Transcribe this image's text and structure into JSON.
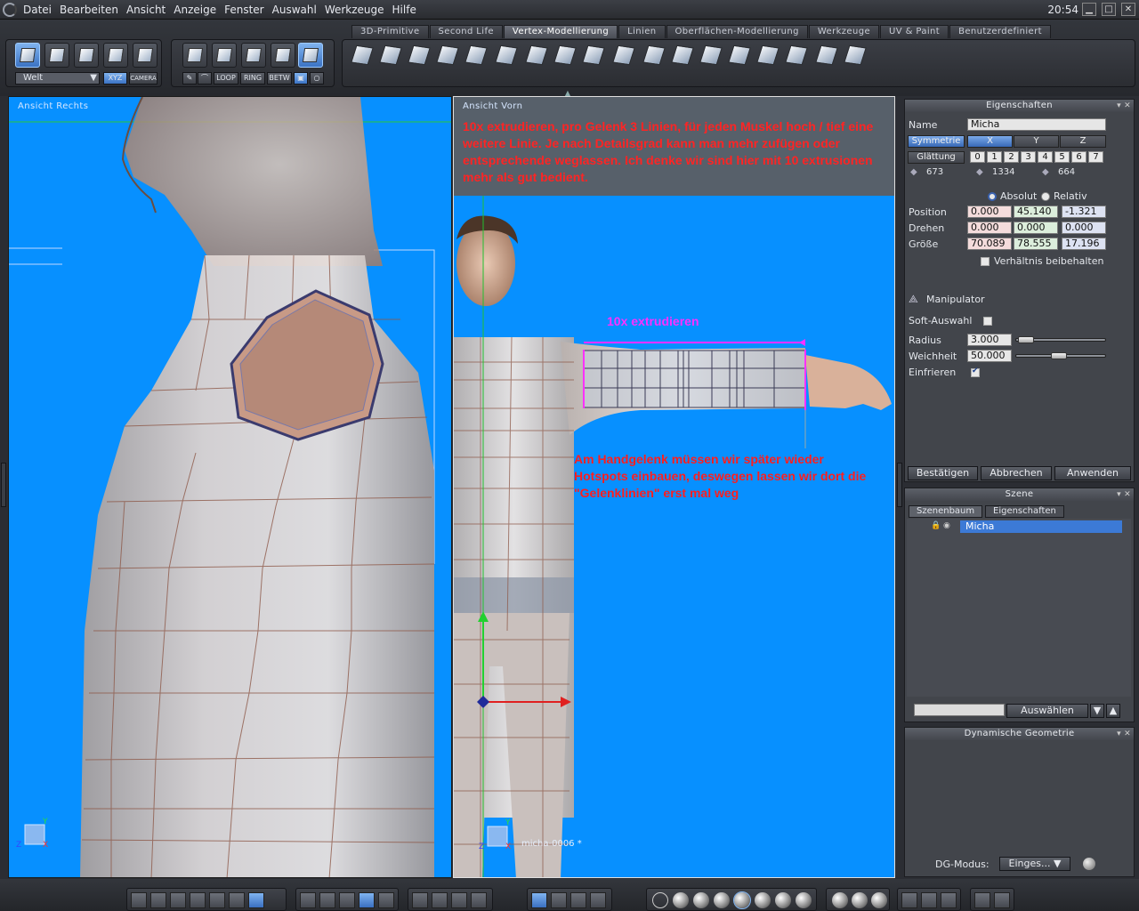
{
  "menubar": {
    "items": [
      "Datei",
      "Bearbeiten",
      "Ansicht",
      "Anzeige",
      "Fenster",
      "Auswahl",
      "Werkzeuge",
      "Hilfe"
    ],
    "clock": "20:54"
  },
  "toolbar": {
    "tabs": [
      "3D-Primitive",
      "Second Life",
      "Vertex-Modellierung",
      "Linien",
      "Oberflächen-Modellierung",
      "Werkzeuge",
      "UV & Paint",
      "Benutzerdefiniert"
    ],
    "active_tab": "Vertex-Modellierung",
    "space_select": "Welt",
    "xyz_label": "XYZ",
    "camera_label": "CAMERA",
    "mode_buttons": [
      "LOOP",
      "RING",
      "BETW"
    ]
  },
  "viewport_left": {
    "label": "Ansicht Rechts"
  },
  "viewport_right": {
    "label": "Ansicht Vorn",
    "note": "10x extrudieren, pro Gelenk 3 Linien, für jeden Muskel hoch / tief eine weitere Linie. Je nach Detailsgrad kann man mehr zufügen oder entsprechende weglassen. Ich denke wir sind hier mit 10 extrusionen mehr als gut bedient.",
    "extrude_label": "10x extrudieren",
    "wrist_note": "Am Handgelenk müssen wir später wieder Hotspots einbauen, deswegen lassen wir dort die \"Gelenklinien\" erst mal weg",
    "object_name": "micha-0006 *"
  },
  "properties": {
    "title": "Eigenschaften",
    "name_label": "Name",
    "name_value": "Micha",
    "symmetry_label": "Symmetrie",
    "axes": [
      "X",
      "Y",
      "Z"
    ],
    "smoothing_label": "Glättung",
    "smoothing_levels": [
      "0",
      "1",
      "2",
      "3",
      "4",
      "5",
      "6",
      "7"
    ],
    "counts": [
      "673",
      "1334",
      "664"
    ],
    "absolute_label": "Absolut",
    "relative_label": "Relativ",
    "position_label": "Position",
    "position": [
      "0.000",
      "45.140",
      "-1.321"
    ],
    "rotate_label": "Drehen",
    "rotate": [
      "0.000",
      "0.000",
      "0.000"
    ],
    "size_label": "Größe",
    "size": [
      "70.089",
      "78.555",
      "17.196"
    ],
    "keep_ratio_label": "Verhältnis beibehalten",
    "manipulator_label": "Manipulator",
    "soft_select_label": "Soft-Auswahl",
    "radius_label": "Radius",
    "radius_value": "3.000",
    "softness_label": "Weichheit",
    "softness_value": "50.000",
    "freeze_label": "Einfrieren",
    "confirm_label": "Bestätigen",
    "cancel_label": "Abbrechen",
    "apply_label": "Anwenden"
  },
  "scene": {
    "title": "Szene",
    "tabs": [
      "Szenenbaum",
      "Eigenschaften"
    ],
    "tree_item": "Micha",
    "select_button": "Auswählen"
  },
  "dynamic_geometry": {
    "title": "Dynamische Geometrie",
    "mode_label": "DG-Modus:",
    "mode_value": "Einges..."
  }
}
